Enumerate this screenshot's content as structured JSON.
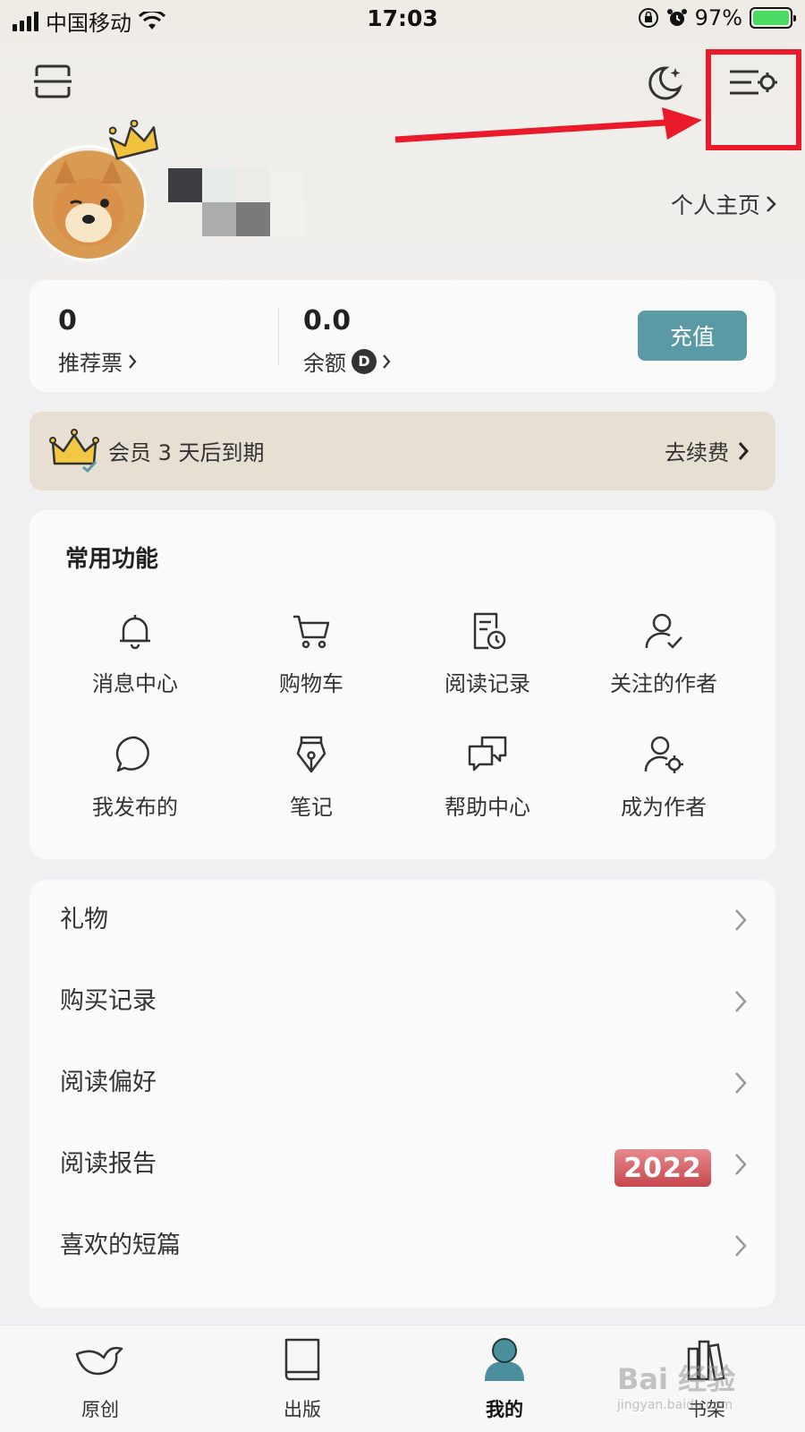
{
  "status_bar": {
    "carrier": "中国移动",
    "time": "17:03",
    "battery_percent": "97%"
  },
  "header": {
    "scan_icon": "scan-icon",
    "night_mode_icon": "moon-icon",
    "settings_icon": "menu-settings-icon"
  },
  "profile": {
    "homepage_label": "个人主页",
    "avatar_icon": "dog-avatar"
  },
  "stats": {
    "tickets_value": "0",
    "tickets_label": "推荐票",
    "balance_value": "0.0",
    "balance_label": "余额",
    "coin_symbol": "D",
    "recharge_label": "充值"
  },
  "membership": {
    "text": "会员 3 天后到期",
    "renew_label": "去续费"
  },
  "functions": {
    "title": "常用功能",
    "items": [
      {
        "label": "消息中心",
        "icon": "bell-icon"
      },
      {
        "label": "购物车",
        "icon": "cart-icon"
      },
      {
        "label": "阅读记录",
        "icon": "history-icon"
      },
      {
        "label": "关注的作者",
        "icon": "follow-user-icon"
      },
      {
        "label": "我发布的",
        "icon": "chat-bubble-icon"
      },
      {
        "label": "笔记",
        "icon": "pen-nib-icon"
      },
      {
        "label": "帮助中心",
        "icon": "help-chat-icon"
      },
      {
        "label": "成为作者",
        "icon": "user-gear-icon"
      }
    ]
  },
  "list": {
    "items": [
      {
        "label": "礼物"
      },
      {
        "label": "购买记录"
      },
      {
        "label": "阅读偏好"
      },
      {
        "label": "阅读报告",
        "badge": "2022"
      },
      {
        "label": "喜欢的短篇"
      }
    ]
  },
  "tabbar": {
    "items": [
      {
        "label": "原创",
        "icon": "bird-icon"
      },
      {
        "label": "出版",
        "icon": "book-icon"
      },
      {
        "label": "我的",
        "icon": "person-icon"
      },
      {
        "label": "书架",
        "icon": "bookshelf-icon"
      }
    ]
  },
  "watermark": {
    "text": "Bai 经验",
    "sub": "jingyan.baidu.com"
  },
  "colors": {
    "accent": "#5a9aa5",
    "annotation_red": "#ea1a2b",
    "member_bg": "#e8dfd3"
  }
}
